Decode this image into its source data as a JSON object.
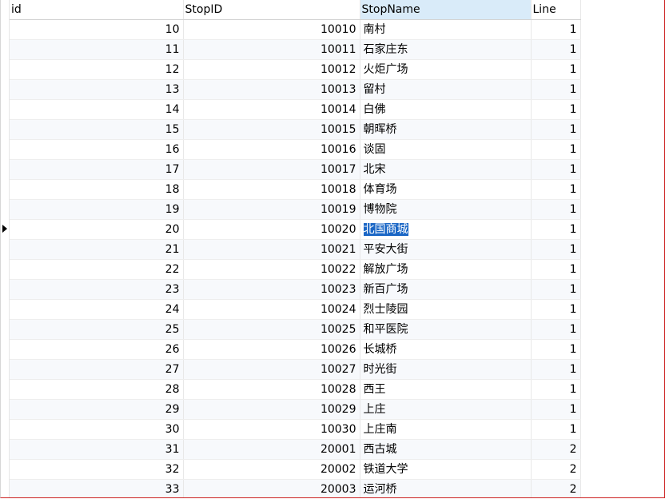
{
  "grid": {
    "columns": [
      "id",
      "StopID",
      "StopName",
      "Line"
    ],
    "selected_row_id": 20,
    "rows": [
      {
        "id": "10",
        "stop_id": "10010",
        "stop_name": "南村",
        "line": "1"
      },
      {
        "id": "11",
        "stop_id": "10011",
        "stop_name": "石家庄东",
        "line": "1"
      },
      {
        "id": "12",
        "stop_id": "10012",
        "stop_name": "火炬广场",
        "line": "1"
      },
      {
        "id": "13",
        "stop_id": "10013",
        "stop_name": "留村",
        "line": "1"
      },
      {
        "id": "14",
        "stop_id": "10014",
        "stop_name": "白佛",
        "line": "1"
      },
      {
        "id": "15",
        "stop_id": "10015",
        "stop_name": "朝晖桥",
        "line": "1"
      },
      {
        "id": "16",
        "stop_id": "10016",
        "stop_name": "谈固",
        "line": "1"
      },
      {
        "id": "17",
        "stop_id": "10017",
        "stop_name": "北宋",
        "line": "1"
      },
      {
        "id": "18",
        "stop_id": "10018",
        "stop_name": "体育场",
        "line": "1"
      },
      {
        "id": "19",
        "stop_id": "10019",
        "stop_name": "博物院",
        "line": "1"
      },
      {
        "id": "20",
        "stop_id": "10020",
        "stop_name": "北国商城",
        "line": "1"
      },
      {
        "id": "21",
        "stop_id": "10021",
        "stop_name": "平安大街",
        "line": "1"
      },
      {
        "id": "22",
        "stop_id": "10022",
        "stop_name": "解放广场",
        "line": "1"
      },
      {
        "id": "23",
        "stop_id": "10023",
        "stop_name": "新百广场",
        "line": "1"
      },
      {
        "id": "24",
        "stop_id": "10024",
        "stop_name": "烈士陵园",
        "line": "1"
      },
      {
        "id": "25",
        "stop_id": "10025",
        "stop_name": "和平医院",
        "line": "1"
      },
      {
        "id": "26",
        "stop_id": "10026",
        "stop_name": "长城桥",
        "line": "1"
      },
      {
        "id": "27",
        "stop_id": "10027",
        "stop_name": "时光街",
        "line": "1"
      },
      {
        "id": "28",
        "stop_id": "10028",
        "stop_name": "西王",
        "line": "1"
      },
      {
        "id": "29",
        "stop_id": "10029",
        "stop_name": "上庄",
        "line": "1"
      },
      {
        "id": "30",
        "stop_id": "10030",
        "stop_name": "上庄南",
        "line": "1"
      },
      {
        "id": "31",
        "stop_id": "20001",
        "stop_name": "西古城",
        "line": "2"
      },
      {
        "id": "32",
        "stop_id": "20002",
        "stop_name": "铁道大学",
        "line": "2"
      },
      {
        "id": "33",
        "stop_id": "20003",
        "stop_name": "运河桥",
        "line": "2"
      }
    ]
  },
  "colors": {
    "header_highlight": "#d9ebf9",
    "selection": "#1a66c5",
    "window_border": "#cc2020"
  },
  "icons": {
    "current_row_marker": "current-row-arrow-icon"
  }
}
